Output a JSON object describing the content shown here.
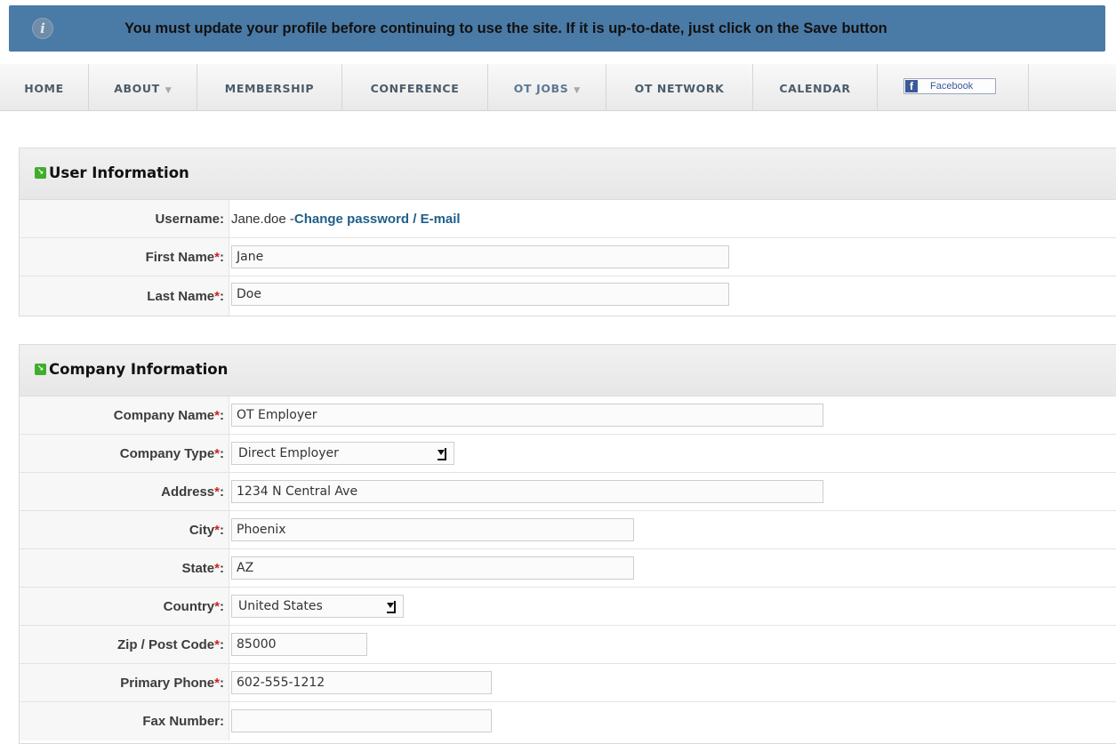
{
  "notice": {
    "icon": "info-icon",
    "text": "You must update your profile before continuing to use the site. If it is up-to-date, just click on the Save button"
  },
  "nav": {
    "items": [
      {
        "label": "HOME"
      },
      {
        "label": "ABOUT",
        "arrow": "▼"
      },
      {
        "label": "MEMBERSHIP"
      },
      {
        "label": "CONFERENCE"
      },
      {
        "label": "OT JOBS",
        "arrow": "▼"
      },
      {
        "label": "OT NETWORK"
      },
      {
        "label": "CALENDAR"
      }
    ],
    "facebook": {
      "logo": "f",
      "label": "Facebook"
    }
  },
  "user_info": {
    "title": "User Information",
    "username_label": "Username:",
    "username_value": "Jane.doe - ",
    "change_link": "Change password / E-mail",
    "first_name_label": "First Name",
    "first_name_value": "Jane",
    "last_name_label": "Last Name",
    "last_name_value": "Doe"
  },
  "company_info": {
    "title": "Company Information",
    "company_name_label": "Company Name",
    "company_name_value": "OT Employer",
    "company_type_label": "Company Type",
    "company_type_value": "Direct Employer",
    "address_label": "Address",
    "address_value": "1234 N Central Ave",
    "city_label": "City",
    "city_value": "Phoenix",
    "state_label": "State",
    "state_value": "AZ",
    "country_label": "Country",
    "country_value": "United States",
    "zip_label": "Zip / Post Code",
    "zip_value": "85000",
    "phone_label": "Primary Phone",
    "phone_value": "602-555-1212",
    "fax_label": "Fax Number:",
    "fax_value": ""
  },
  "required_mark": "*",
  "colon": ":"
}
